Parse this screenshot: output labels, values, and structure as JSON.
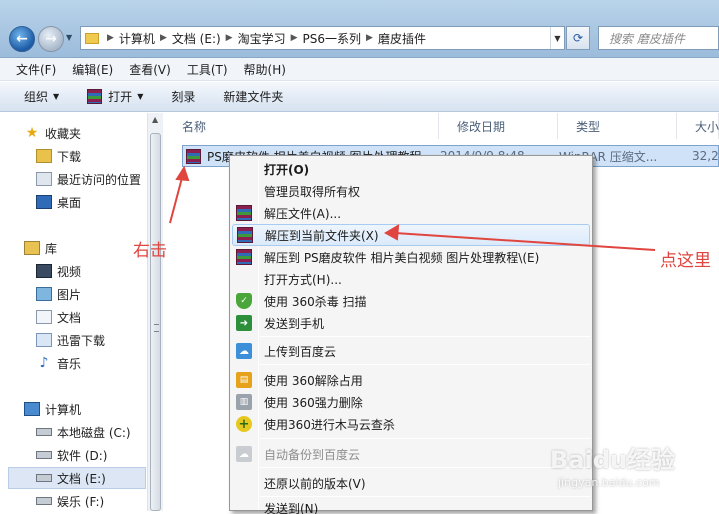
{
  "address": {
    "crumbs": [
      "计算机",
      "文档 (E:)",
      "淘宝学习",
      "PS6一系列",
      "磨皮插件"
    ],
    "search_placeholder": "搜索 磨皮插件"
  },
  "menubar": [
    "文件(F)",
    "编辑(E)",
    "查看(V)",
    "工具(T)",
    "帮助(H)"
  ],
  "toolbar": {
    "organize": "组织",
    "open": "打开",
    "burn": "刻录",
    "new_folder": "新建文件夹"
  },
  "navpane": {
    "favorites": "收藏夹",
    "download": "下载",
    "recent": "最近访问的位置",
    "desktop": "桌面",
    "libraries": "库",
    "videos": "视频",
    "pictures": "图片",
    "documents": "文档",
    "thunder": "迅雷下载",
    "music": "音乐",
    "computer": "计算机",
    "drive_c": "本地磁盘 (C:)",
    "drive_d": "软件 (D:)",
    "drive_e": "文档 (E:)",
    "drive_f": "娱乐 (F:)"
  },
  "columns": {
    "name": "名称",
    "date": "修改日期",
    "type": "类型",
    "size": "大小"
  },
  "file": {
    "name": "PS磨皮软件 相片美白视频 图片处理教程",
    "date": "2014/9/9 8:48",
    "type": "WinRAR 压缩文...",
    "size": "32,2"
  },
  "context_menu": {
    "open": "打开(O)",
    "admin": "管理员取得所有权",
    "extract": "解压文件(A)...",
    "extract_here": "解压到当前文件夹(X)",
    "extract_to": "解压到 PS磨皮软件 相片美白视频 图片处理教程\\(E)",
    "open_with": "打开方式(H)...",
    "scan360": "使用 360杀毒 扫描",
    "send_phone": "发送到手机",
    "upload_baidu": "上传到百度云",
    "unlock360": "使用 360解除占用",
    "force_delete": "使用 360强力删除",
    "cloud_scan": "使用360进行木马云查杀",
    "auto_backup": "自动备份到百度云",
    "restore": "还原以前的版本(V)",
    "more": "发送到(N)"
  },
  "annotations": {
    "right_click": "右击",
    "click_here": "点这里"
  },
  "watermark": {
    "brand": "Baidu经验",
    "url": "jingyan.baidu.com"
  },
  "colors": {
    "annotation": "#e0453f",
    "selection": "#cfe2f8",
    "menu_hover_border": "#a8cbf1"
  }
}
